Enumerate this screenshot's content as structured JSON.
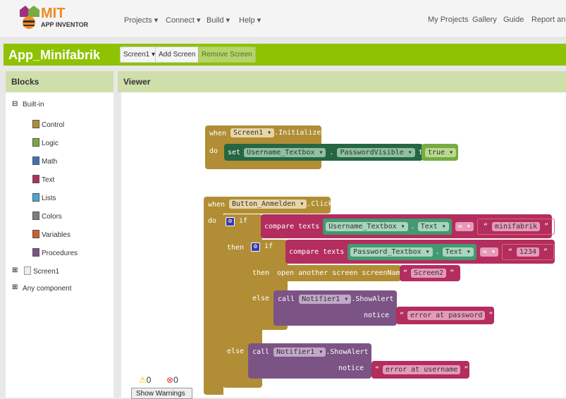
{
  "header": {
    "logo_top": "MIT",
    "logo_bottom": "APP INVENTOR",
    "nav": [
      "Projects ▾",
      "Connect ▾",
      "Build ▾",
      "Help ▾"
    ],
    "right_nav": [
      "My Projects",
      "Gallery",
      "Guide",
      "Report an Issue"
    ]
  },
  "project": {
    "title": "App_Minifabrik",
    "screen_select": "Screen1 ▾",
    "add_screen": "Add Screen ...",
    "remove_screen": "Remove Screen"
  },
  "blocks_panel": {
    "title": "Blocks",
    "builtin": "Built-in",
    "items": [
      {
        "label": "Control",
        "color": "#b18e35"
      },
      {
        "label": "Logic",
        "color": "#77ab41"
      },
      {
        "label": "Math",
        "color": "#3f71b5"
      },
      {
        "label": "Text",
        "color": "#b32d5e"
      },
      {
        "label": "Lists",
        "color": "#49a6d4"
      },
      {
        "label": "Colors",
        "color": "#7d7d7d"
      },
      {
        "label": "Variables",
        "color": "#d05f2d"
      },
      {
        "label": "Procedures",
        "color": "#7c5385"
      }
    ],
    "screen": "Screen1",
    "any": "Any component"
  },
  "viewer": {
    "title": "Viewer",
    "warnings": "0",
    "errors": "0",
    "show_warnings": "Show Warnings"
  },
  "code": {
    "init": {
      "when": "when",
      "component": "Screen1 ▾",
      "event": ".Initialize",
      "do": "do",
      "set": "set",
      "target": "Username_Textbox ▾",
      "dot": ".",
      "prop": "PasswordVisible ▾",
      "to": "to",
      "value": "true ▾"
    },
    "click": {
      "when": "when",
      "component": "Button_Anmelden ▾",
      "event": ".Click",
      "do": "do",
      "if": "if",
      "then": "then",
      "else": "else",
      "compare": "compare texts",
      "cmp1": {
        "comp": "Username_Textbox ▾",
        "prop": "Text ▾",
        "op": "= ▾",
        "text": "minifabrik"
      },
      "cmp2": {
        "comp": "Password_Textbox ▾",
        "prop": "Text ▾",
        "op": "= ▾",
        "text": "1234"
      },
      "open": "open another screen  screenName",
      "screen2": "Screen2",
      "call": "call",
      "notifier": "Notifier1 ▾",
      "method": ".ShowAlert",
      "notice": "notice",
      "err_pw": "error at password",
      "err_user": "error at username"
    }
  }
}
